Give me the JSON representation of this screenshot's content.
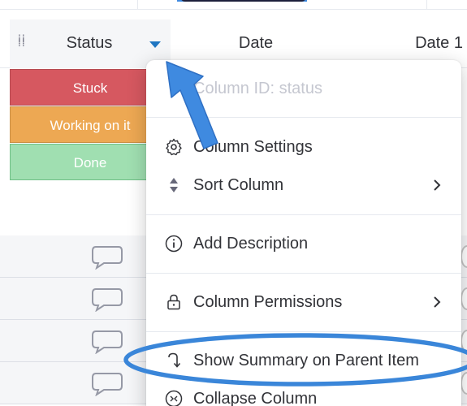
{
  "header": {
    "status_label": "Status",
    "date_label": "Date",
    "date1_label": "Date 1"
  },
  "status_cells": [
    {
      "label": "Stuck",
      "color": "#d65860"
    },
    {
      "label": "Working on it",
      "color": "#eda853"
    },
    {
      "label": "Done",
      "color": "#a0dfb1"
    }
  ],
  "menu": {
    "column_id": "Column ID: status",
    "items": {
      "column_settings": "Column Settings",
      "sort_column": "Sort Column",
      "add_description": "Add Description",
      "column_permissions": "Column Permissions",
      "show_summary": "Show Summary on Parent Item",
      "collapse_column": "Collapse Column"
    }
  },
  "icons": [
    "drag-grip-icon",
    "caret-down-icon",
    "comment-icon",
    "gear-icon",
    "sort-icon",
    "info-icon",
    "lock-icon",
    "return-arrow-icon",
    "collapse-icon",
    "chevron-right-icon"
  ],
  "colors": {
    "annotation_blue": "#3f8ae0",
    "stuck": "#d65860",
    "working": "#eda853",
    "done": "#a0dfb1"
  }
}
